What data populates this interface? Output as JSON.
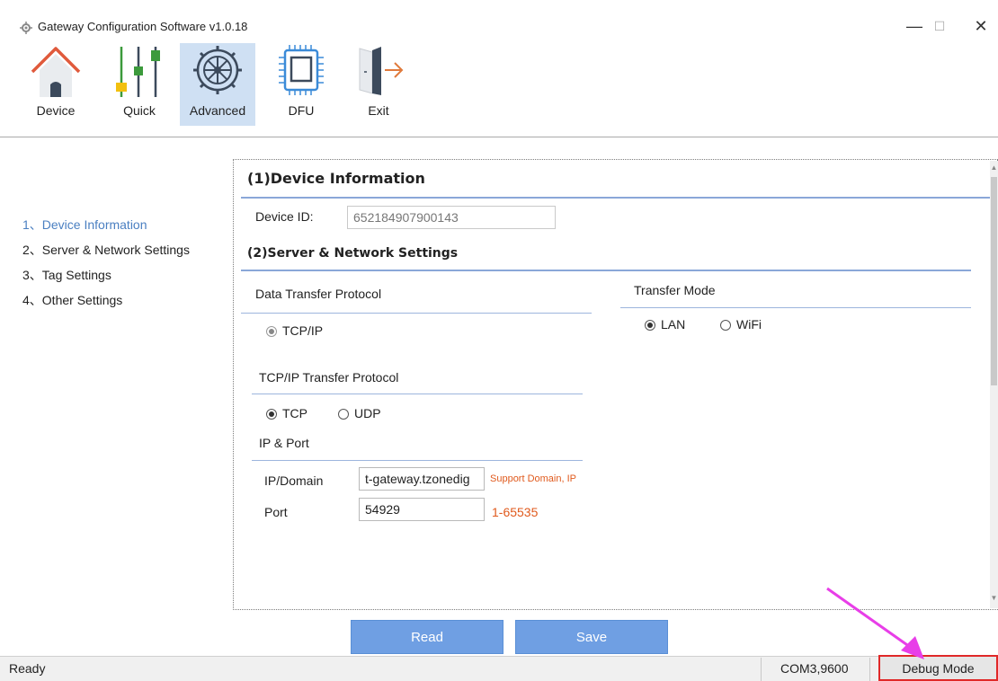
{
  "window": {
    "title": "Gateway Configuration Software v1.0.18",
    "minimize": "—",
    "maximize": "☐",
    "close": "✕"
  },
  "toolbar": {
    "items": [
      {
        "label": "Device",
        "icon": "home-icon"
      },
      {
        "label": "Quick",
        "icon": "sliders-icon"
      },
      {
        "label": "Advanced",
        "icon": "gear-icon",
        "active": true
      },
      {
        "label": "DFU",
        "icon": "chip-icon"
      },
      {
        "label": "Exit",
        "icon": "exit-door-icon"
      }
    ]
  },
  "nav": {
    "items": [
      {
        "label": "1、Device Information",
        "active": true
      },
      {
        "label": "2、Server & Network Settings"
      },
      {
        "label": "3、Tag Settings"
      },
      {
        "label": "4、Other Settings"
      }
    ]
  },
  "device_info": {
    "title": "(1)Device Information",
    "device_id_label": "Device ID:",
    "device_id_value": "652184907900143"
  },
  "server": {
    "title": "(2)Server & Network Settings",
    "protocol_label": "Data Transfer Protocol",
    "protocol_option": "TCP/IP",
    "transfer_mode_label": "Transfer Mode",
    "transfer_modes": [
      "LAN",
      "WiFi"
    ],
    "transfer_mode_selected": "LAN",
    "tcpip_label": "TCP/IP Transfer Protocol",
    "tcpip_options": [
      "TCP",
      "UDP"
    ],
    "tcpip_selected": "TCP",
    "ip_port_label": "IP & Port",
    "ip_label": "IP/Domain",
    "ip_value": "t-gateway.tzonedig",
    "ip_hint": "Support Domain, IP",
    "port_label": "Port",
    "port_value": "54929",
    "port_hint": "1-65535"
  },
  "buttons": {
    "read": "Read",
    "save": "Save"
  },
  "status": {
    "text": "Ready",
    "com": "COM3,9600",
    "debug": "Debug Mode"
  },
  "colors": {
    "accent": "#6f9fe3",
    "active_nav": "#4a7fc1",
    "hint": "#e05a1d",
    "annotation_arrow": "#e83ee8",
    "highlight_box": "#e02828"
  }
}
